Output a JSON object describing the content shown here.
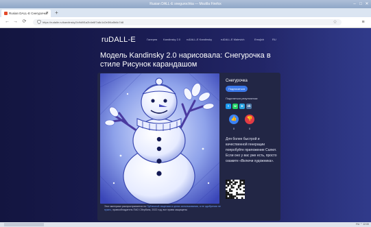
{
  "window": {
    "title": "Rusian DALL-E snegurochka — Mozilla Firefox",
    "minimize": "–",
    "maximize": "□",
    "close": "✕"
  },
  "tab": {
    "label": "Rusian DALL-E Снегурочка",
    "close": "✕",
    "new_tab": "+"
  },
  "toolbar": {
    "back": "←",
    "forward": "→",
    "reload": "⟳",
    "lock_icon": "shield-icon",
    "url": "https://rudalle.ru/kandinsky2/c9d8f1a2b4e6f7a8c1d2e3f4a5b6c7d8",
    "star": "☆",
    "menu": "≡"
  },
  "site": {
    "brand": "ruDALL-E",
    "nav": [
      "Галерея",
      "Kandinsky 2.0",
      "ruDALL-E Kandinsky",
      "ruDALL-E Malevich",
      "Emojich",
      "RU"
    ]
  },
  "headline": "Модель Kandinsky 2.0 нарисовала: Снегурочка в стиле Рисунок карандашом",
  "card": {
    "title": "Снегурочка",
    "subscribe_label": "Подписаться",
    "share_label": "Поделиться результатом:",
    "share_buttons": [
      {
        "icon": "twitter-icon",
        "glyph": "t",
        "color": "#1d9bf0"
      },
      {
        "icon": "whatsapp-icon",
        "glyph": "w",
        "color": "#25d366"
      },
      {
        "icon": "telegram-icon",
        "glyph": "➤",
        "color": "#2aa3e0"
      },
      {
        "icon": "vk-icon",
        "glyph": "vk",
        "color": "#4c75a3"
      }
    ],
    "like": {
      "glyph": "👍",
      "count": "0",
      "color": "#3b82f6"
    },
    "dislike": {
      "glyph": "👎",
      "count": "0",
      "color": "#e23b45"
    },
    "promo": "Для более быстрой и качественной генерации попробуйте приложение Салют. Если оно у вас уже есть, просто скажите «Включи художника».",
    "note_prefix": "Этот материал распространяется по ",
    "note_link": "Публичной лицензии в целях использования, а ее одобрения не нужно",
    "note_suffix": ", правообладатель ПАО Сбербанк, 2022 год, все права защищены"
  },
  "taskbar": {
    "tray_text": "RU  ⌃  12:00"
  }
}
